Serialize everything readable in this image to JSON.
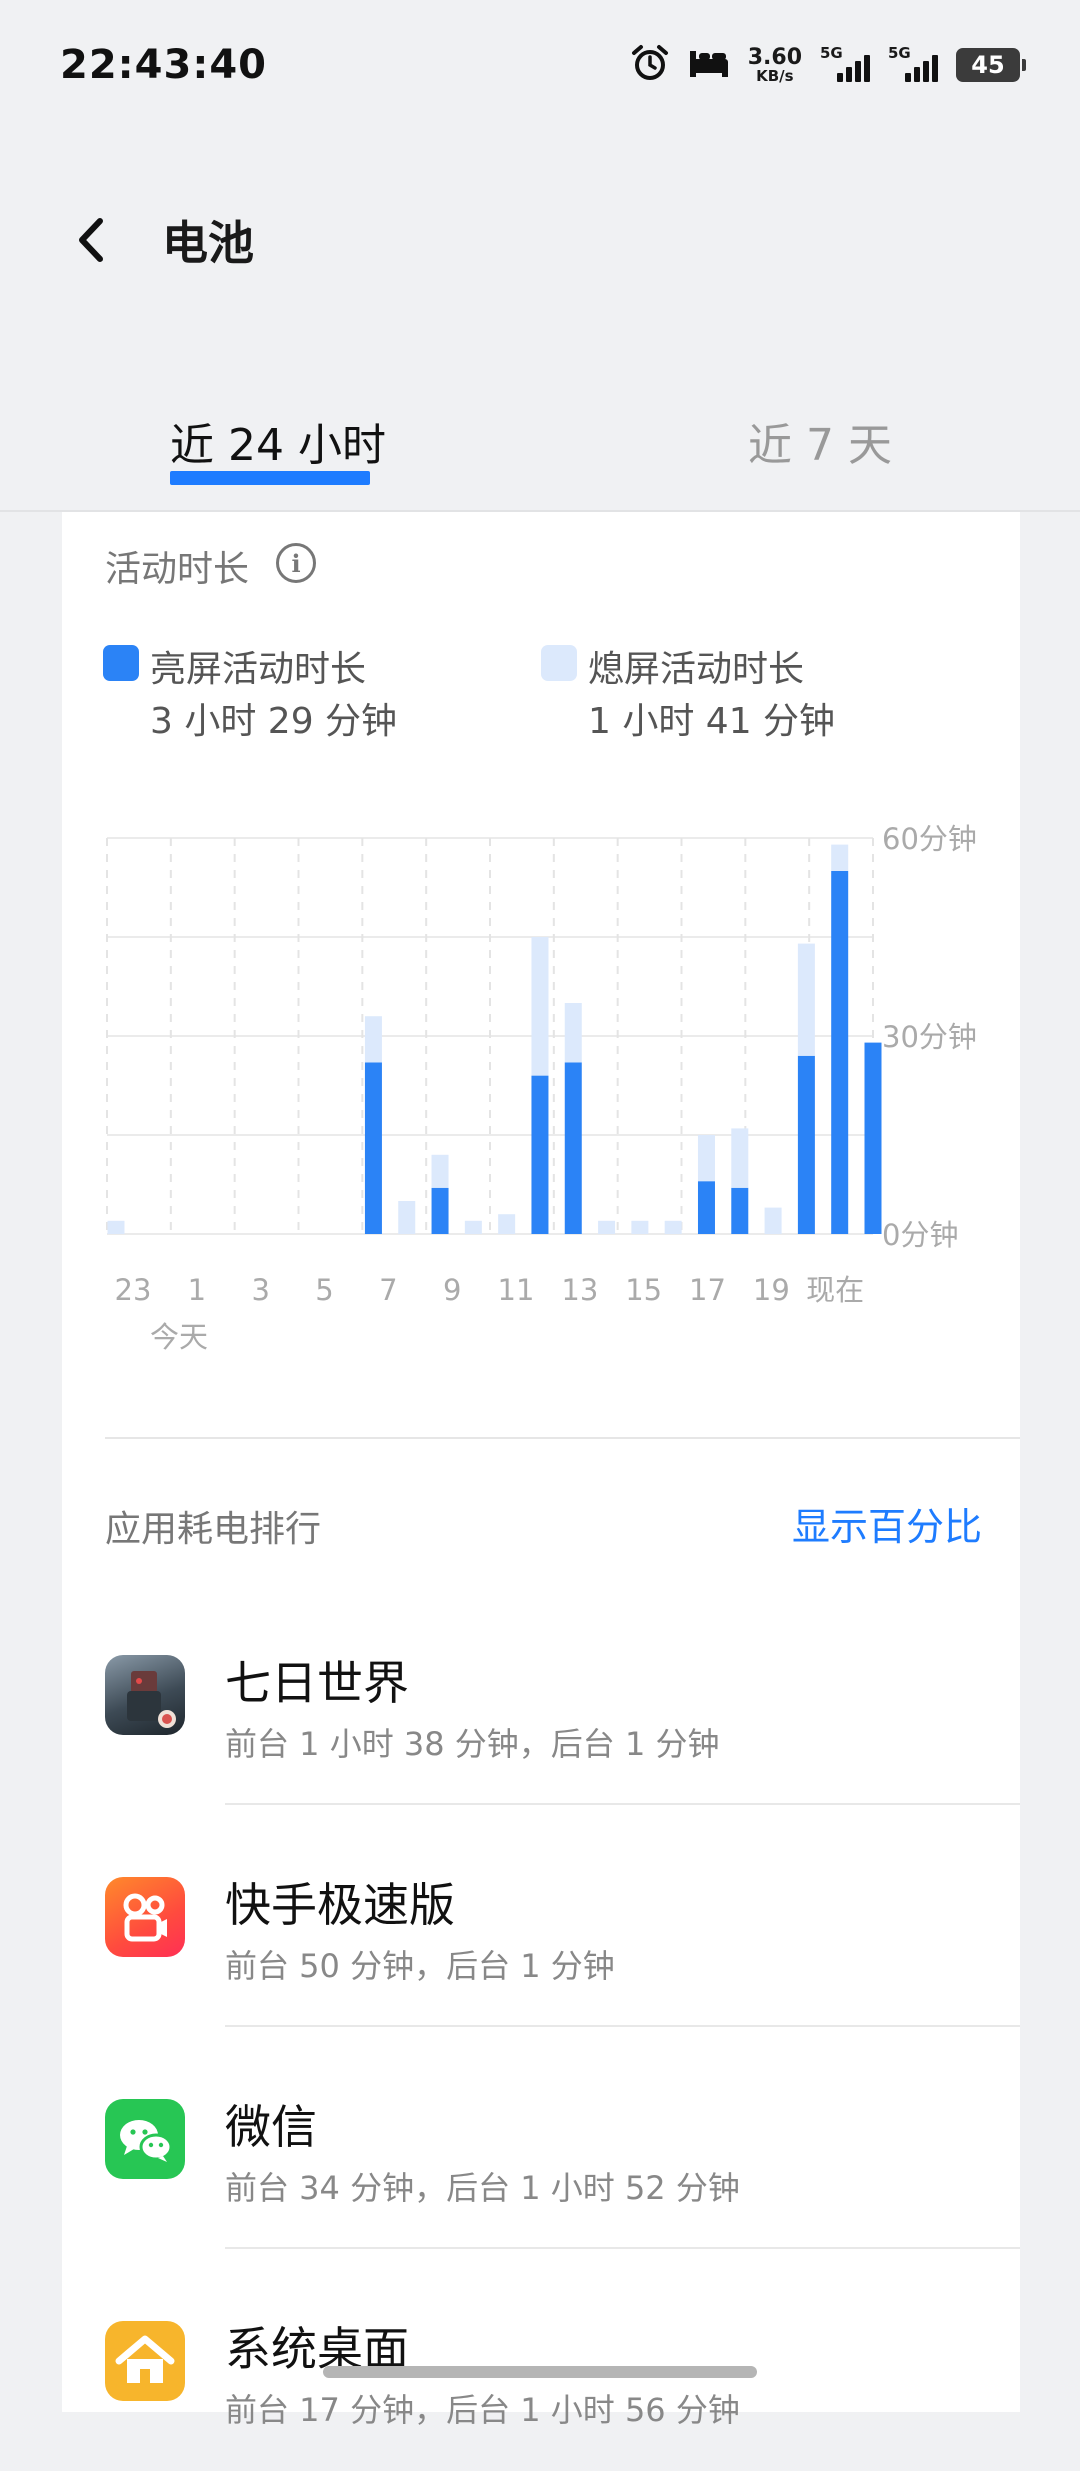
{
  "status_bar": {
    "time": "22:43:40",
    "net_speed_value": "3.60",
    "net_speed_unit": "KB/s",
    "sim1_label": "5G",
    "sim2_label": "5G",
    "battery_level": "45",
    "icons": [
      "alarm-icon",
      "bed-icon",
      "signal-icon",
      "signal-icon",
      "battery-icon"
    ]
  },
  "header": {
    "back_icon": "chevron-left-icon",
    "title": "电池"
  },
  "tabs": [
    {
      "label": "近 24 小时",
      "active": true
    },
    {
      "label": "近 7 天",
      "active": false
    }
  ],
  "activity": {
    "section_label": "活动时长",
    "info_icon": "info-icon",
    "legend": [
      {
        "label": "亮屏活动时长",
        "value": "3 小时 29 分钟",
        "color": "#2b83f6"
      },
      {
        "label": "熄屏活动时长",
        "value": "1 小时 41 分钟",
        "color": "#dce9fc"
      }
    ]
  },
  "chart_data": {
    "type": "bar",
    "stacked": true,
    "x_tick_labels": [
      "23",
      "1",
      "3",
      "5",
      "7",
      "9",
      "11",
      "13",
      "15",
      "17",
      "19",
      "现在"
    ],
    "x_sublabel": "今天",
    "y_tick_labels": [
      "60分钟",
      "30分钟",
      "0分钟"
    ],
    "ylim": [
      0,
      60
    ],
    "categories": [
      "23",
      "0",
      "1",
      "2",
      "3",
      "4",
      "5",
      "6",
      "7",
      "8",
      "9",
      "10",
      "11",
      "12",
      "13",
      "14",
      "15",
      "16",
      "17",
      "18",
      "19",
      "20",
      "21",
      "22"
    ],
    "series": [
      {
        "name": "亮屏活动时长",
        "color": "#2b83f6",
        "values": [
          0,
          0,
          0,
          0,
          0,
          0,
          0,
          0,
          26,
          0,
          7,
          0,
          0,
          24,
          26,
          0,
          0,
          0,
          8,
          7,
          0,
          27,
          55,
          29
        ]
      },
      {
        "name": "熄屏活动时长",
        "color": "#dce9fc",
        "values": [
          2,
          0,
          0,
          0,
          0,
          0,
          0,
          0,
          7,
          5,
          5,
          2,
          3,
          21,
          9,
          2,
          2,
          2,
          7,
          9,
          4,
          17,
          4,
          0
        ]
      }
    ],
    "grid": true,
    "y_axis_position": "right"
  },
  "ranking": {
    "title": "应用耗电排行",
    "toggle_label": "显示百分比",
    "apps": [
      {
        "name": "七日世界",
        "usage": "前台 1 小时 38 分钟，后台 1 分钟",
        "icon": "game-icon"
      },
      {
        "name": "快手极速版",
        "usage": "前台 50 分钟，后台 1 分钟",
        "icon": "kuaishou-icon"
      },
      {
        "name": "微信",
        "usage": "前台 34 分钟，后台 1 小时 52 分钟",
        "icon": "wechat-icon"
      },
      {
        "name": "系统桌面",
        "usage": "前台 17 分钟，后台 1 小时 56 分钟",
        "icon": "home-icon"
      }
    ]
  }
}
